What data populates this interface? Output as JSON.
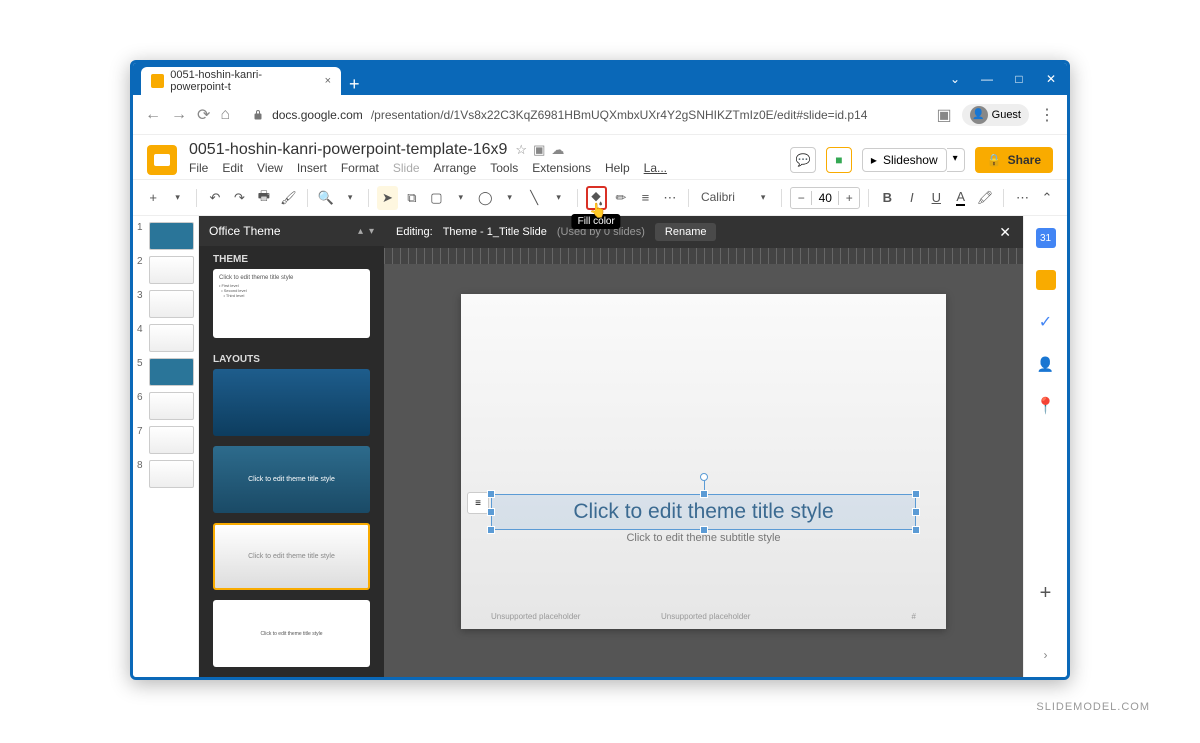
{
  "browser": {
    "tab_title": "0051-hoshin-kanri-powerpoint-t",
    "url_host": "docs.google.com",
    "url_path": "/presentation/d/1Vs8x22C3KqZ6981HBmUQXmbxUXr4Y2gSNHIKZTmIz0E/edit#slide=id.p14",
    "guest_label": "Guest"
  },
  "app": {
    "doc_title": "0051-hoshin-kanri-powerpoint-template-16x9",
    "menus": [
      "File",
      "Edit",
      "View",
      "Insert",
      "Format",
      "Slide",
      "Arrange",
      "Tools",
      "Extensions",
      "Help",
      "La..."
    ],
    "slideshow_label": "Slideshow",
    "share_label": "Share"
  },
  "toolbar": {
    "font": "Calibri",
    "font_size": "40",
    "tooltip_fill": "Fill color"
  },
  "theme_panel": {
    "title": "Office Theme",
    "section_theme": "THEME",
    "section_layouts": "LAYOUTS",
    "theme_placeholder": "Click to edit theme title style",
    "layout2_text": "Click to edit theme title style",
    "layout3_text": "Click to edit theme title style",
    "layout4_text": "Click to edit theme title style"
  },
  "canvas": {
    "editing_prefix": "Editing:",
    "editing_name": "Theme - 1_Title Slide",
    "used_by": "(Used by 0 slides)",
    "rename_label": "Rename",
    "title_placeholder": "Click to edit theme title style",
    "subtitle_placeholder": "Click to edit theme subtitle style",
    "unsupported": "Unsupported placeholder",
    "page_num": "#"
  },
  "side_rail": {
    "calendar_day": "31"
  },
  "thumbs": [
    "1",
    "2",
    "3",
    "4",
    "5",
    "6",
    "7",
    "8"
  ],
  "watermark": "SLIDEMODEL.COM"
}
